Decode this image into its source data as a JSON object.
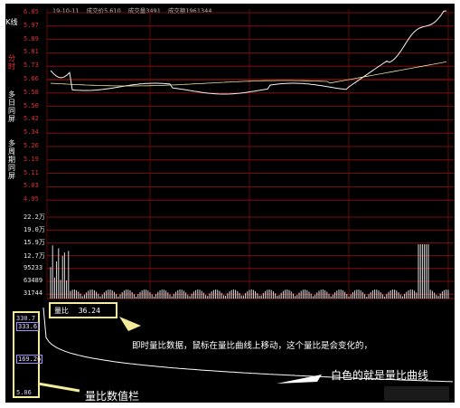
{
  "sidebar": {
    "tabs": [
      {
        "label": "K线",
        "active": false
      },
      {
        "label": "分时",
        "active": true
      },
      {
        "label": "多日同屏",
        "active": false
      },
      {
        "label": "多周期同屏",
        "active": false
      }
    ]
  },
  "header": {
    "date": "19-10-11",
    "price": "成交价5.610",
    "volume": "成交量3491",
    "amount": "成交额1961344"
  },
  "price_axis": [
    "6.05",
    "5.97",
    "5.89",
    "5.81",
    "5.73",
    "5.66",
    "5.58",
    "5.50",
    "5.42",
    "5.34",
    "5.26",
    "5.19",
    "5.11",
    "5.03",
    "4.95"
  ],
  "volume_axis": [
    "22.2万",
    "19.0万",
    "15.9万",
    "12.7万",
    "95233",
    "63489",
    "31744"
  ],
  "ratio_axis": [
    "330.7",
    "333.6",
    "169.26",
    "5.06"
  ],
  "ratio_readout": {
    "label": "量比",
    "value": "36.24"
  },
  "annotations": {
    "realtime_note": "即时量比数据，鼠标在量比曲线上移动，这个量比是会变化的，",
    "ratio_column_note": "量比数值栏",
    "white_curve_note": "白色的就是量比曲线"
  },
  "colors": {
    "background": "#000000",
    "grid": "#9a1010",
    "price_line": "#ffffff",
    "volume_bars": "#dddddd",
    "callout": "#f4ea9c"
  }
}
